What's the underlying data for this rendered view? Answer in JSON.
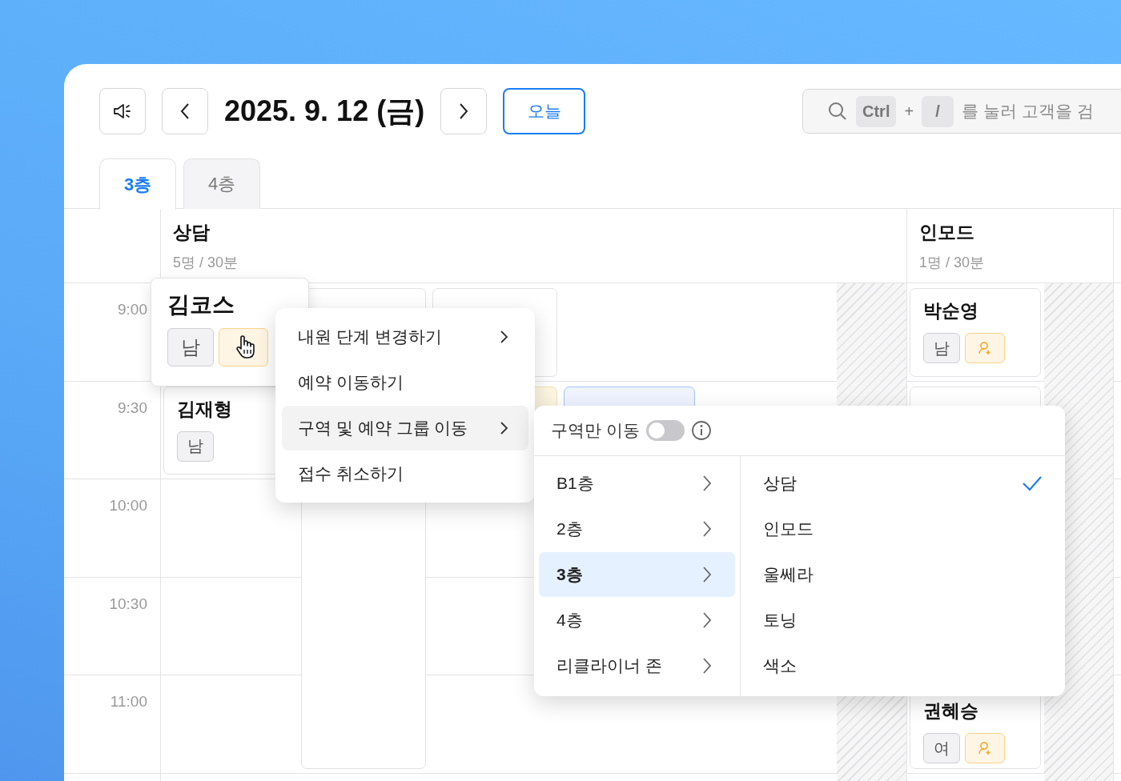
{
  "toolbar": {
    "date": "2025. 9. 12 (금)",
    "today_button": "오늘",
    "search": {
      "key_1": "Ctrl",
      "plus": "+",
      "key_2": "/",
      "placeholder": "를 눌러 고객을 검"
    }
  },
  "tabs": [
    {
      "label": "3층",
      "selected": true
    },
    {
      "label": "4층",
      "selected": false
    }
  ],
  "groups": [
    {
      "name": "상담",
      "meta": "5명 / 30분"
    },
    {
      "name": "인모드",
      "meta": "1명 / 30분"
    }
  ],
  "times": [
    "9:00",
    "9:30",
    "10:00",
    "10:30",
    "11:00"
  ],
  "cards": [
    {
      "name": "김재형",
      "tags": [
        {
          "kind": "gender",
          "label": "남"
        }
      ]
    },
    {
      "name": "박순영",
      "tags": [
        {
          "kind": "gender",
          "label": "남"
        },
        {
          "kind": "new"
        }
      ]
    },
    {
      "name": "권혜승",
      "tags": [
        {
          "kind": "gender",
          "label": "여"
        },
        {
          "kind": "new"
        }
      ]
    }
  ],
  "lifted_card": {
    "name": "김코스",
    "tags": [
      {
        "kind": "gender",
        "label": "남"
      },
      {
        "kind": "new"
      }
    ]
  },
  "context_menu": [
    {
      "label": "내원 단계 변경하기",
      "submenu": true,
      "selected": false
    },
    {
      "label": "예약 이동하기",
      "submenu": false,
      "selected": false
    },
    {
      "label": "구역 및 예약 그룹 이동",
      "submenu": true,
      "selected": true
    },
    {
      "label": "접수 취소하기",
      "submenu": false,
      "selected": false
    }
  ],
  "move_menu": {
    "toggle_label": "구역만 이동",
    "toggle_on": false,
    "floors": [
      {
        "label": "B1층",
        "selected": false
      },
      {
        "label": "2층",
        "selected": false
      },
      {
        "label": "3층",
        "selected": true
      },
      {
        "label": "4층",
        "selected": false
      },
      {
        "label": "리클라이너 존",
        "selected": false
      }
    ],
    "zones": [
      {
        "label": "상담",
        "checked": true
      },
      {
        "label": "인모드",
        "checked": false
      },
      {
        "label": "울쎄라",
        "checked": false
      },
      {
        "label": "토닝",
        "checked": false
      },
      {
        "label": "색소",
        "checked": false
      }
    ]
  }
}
